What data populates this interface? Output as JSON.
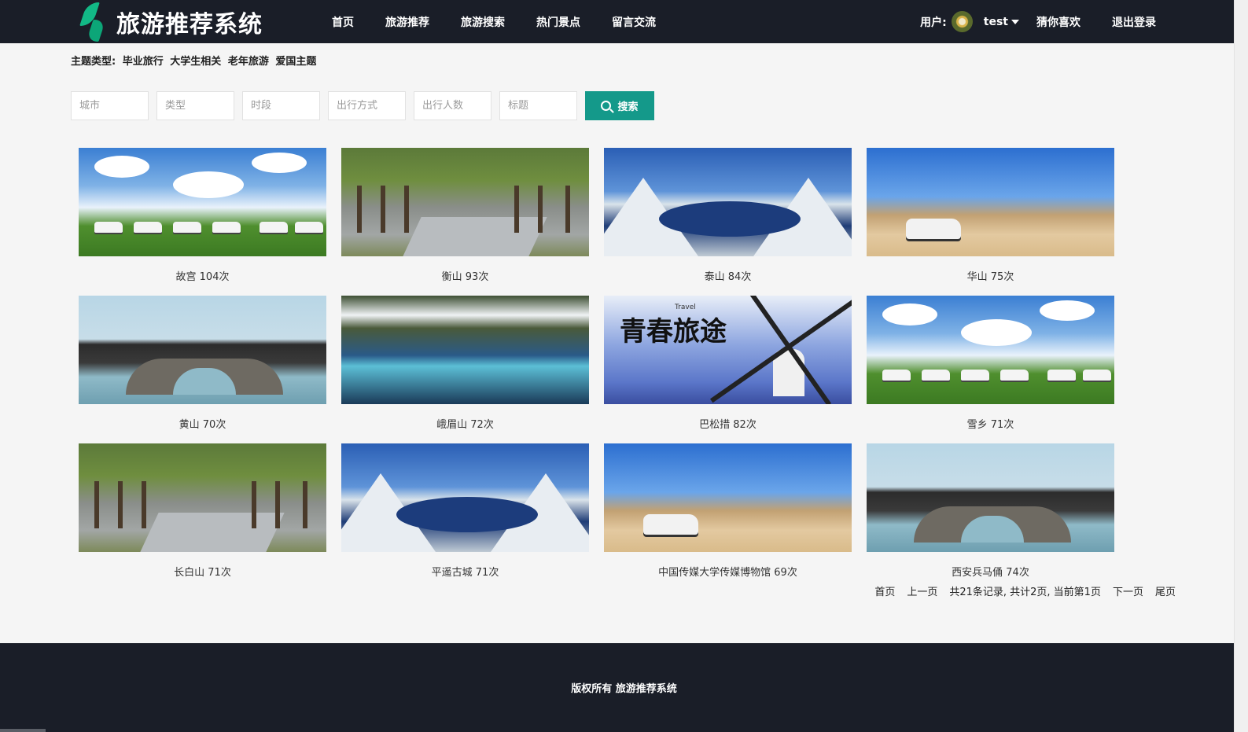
{
  "app": {
    "title": "旅游推荐系统"
  },
  "nav": [
    "首页",
    "旅游推荐",
    "旅游搜索",
    "热门景点",
    "留言交流"
  ],
  "user": {
    "label": "用户:",
    "name": "test",
    "links": [
      "猜你喜欢",
      "退出登录"
    ]
  },
  "topic": {
    "label": "主题类型:",
    "items": [
      "毕业旅行",
      "大学生相关",
      "老年旅游",
      "爱国主题"
    ]
  },
  "search": {
    "placeholders": [
      "城市",
      "类型",
      "时段",
      "出行方式",
      "出行人数",
      "标题"
    ],
    "button_label": "搜索"
  },
  "cards": [
    {
      "caption": "故宫 104次",
      "scene": "cars"
    },
    {
      "caption": "衡山 93次",
      "scene": "trees"
    },
    {
      "caption": "泰山 84次",
      "scene": "lake"
    },
    {
      "caption": "华山 75次",
      "scene": "desert"
    },
    {
      "caption": "黄山 70次",
      "scene": "bridge"
    },
    {
      "caption": "峨眉山 72次",
      "scene": "pools"
    },
    {
      "caption": "巴松措 82次",
      "scene": "wind"
    },
    {
      "caption": "雪乡 71次",
      "scene": "cars"
    },
    {
      "caption": "长白山 71次",
      "scene": "trees"
    },
    {
      "caption": "平遥古城 71次",
      "scene": "lake"
    },
    {
      "caption": "中国传媒大学传媒博物馆 69次",
      "scene": "desert"
    },
    {
      "caption": "西安兵马俑 74次",
      "scene": "bridge"
    }
  ],
  "thumb_text": {
    "wind_title": "青春旅途",
    "wind_sub": "Travel"
  },
  "pager": [
    "首页",
    "上一页",
    "共21条记录, 共计2页, 当前第1页",
    "下一页",
    "尾页"
  ],
  "footer": {
    "text": "版权所有 旅游推荐系统"
  },
  "colors": {
    "header_bg": "#1a1e28",
    "accent": "#14998a",
    "page_bg": "#f5f5f5"
  }
}
